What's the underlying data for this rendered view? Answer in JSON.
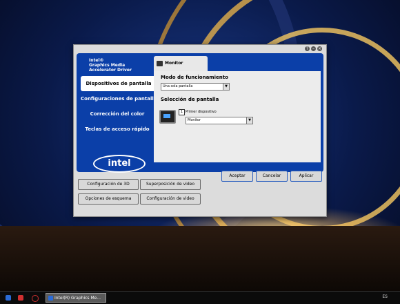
{
  "brand": {
    "lines": [
      "Intel®",
      "Graphics Media",
      "Accelerator Driver"
    ],
    "logo_text": "intel"
  },
  "window_controls": [
    "help-icon",
    "minimize-icon",
    "close-icon"
  ],
  "nav": [
    {
      "label": "Dispositivos de pantalla",
      "active": true
    },
    {
      "label": "Configuraciones de pantalla",
      "active": false
    },
    {
      "label": "Corrección del color",
      "active": false
    },
    {
      "label": "Teclas de acceso rápido",
      "active": false
    }
  ],
  "tab": {
    "label": "Monitor",
    "icon": "monitor-icon"
  },
  "panel": {
    "mode_title": "Modo de funcionamiento",
    "mode_value": "Una sola pantalla",
    "selection_title": "Selección de pantalla",
    "device_number": "1",
    "device_label": "Primer dispositivo",
    "device_value": "Monitor"
  },
  "dialog_buttons": {
    "accept": "Aceptar",
    "cancel": "Cancelar",
    "apply": "Aplicar"
  },
  "bottom_buttons": [
    "Configuración de 3D",
    "Superposición de video",
    "Opciones de esquema",
    "Configuración de video"
  ],
  "taskbar": {
    "task_label": "Intel(R) Graphics Me...",
    "language": "ES"
  }
}
